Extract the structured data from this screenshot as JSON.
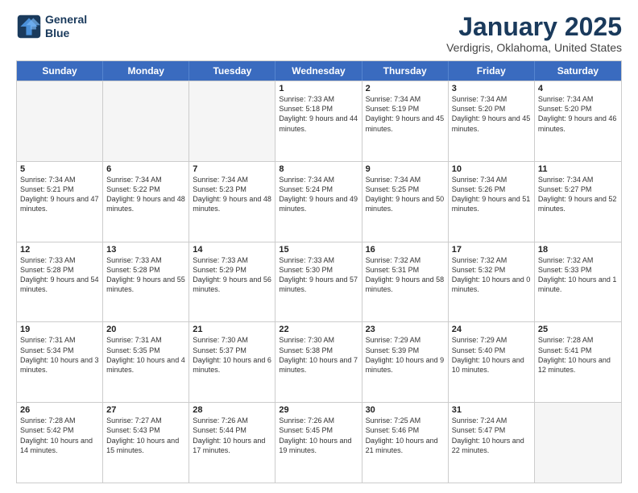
{
  "logo": {
    "line1": "General",
    "line2": "Blue"
  },
  "title": "January 2025",
  "location": "Verdigris, Oklahoma, United States",
  "days_of_week": [
    "Sunday",
    "Monday",
    "Tuesday",
    "Wednesday",
    "Thursday",
    "Friday",
    "Saturday"
  ],
  "weeks": [
    [
      {
        "num": "",
        "sunrise": "",
        "sunset": "",
        "daylight": "",
        "empty": true
      },
      {
        "num": "",
        "sunrise": "",
        "sunset": "",
        "daylight": "",
        "empty": true
      },
      {
        "num": "",
        "sunrise": "",
        "sunset": "",
        "daylight": "",
        "empty": true
      },
      {
        "num": "1",
        "sunrise": "Sunrise: 7:33 AM",
        "sunset": "Sunset: 5:18 PM",
        "daylight": "Daylight: 9 hours and 44 minutes."
      },
      {
        "num": "2",
        "sunrise": "Sunrise: 7:34 AM",
        "sunset": "Sunset: 5:19 PM",
        "daylight": "Daylight: 9 hours and 45 minutes."
      },
      {
        "num": "3",
        "sunrise": "Sunrise: 7:34 AM",
        "sunset": "Sunset: 5:20 PM",
        "daylight": "Daylight: 9 hours and 45 minutes."
      },
      {
        "num": "4",
        "sunrise": "Sunrise: 7:34 AM",
        "sunset": "Sunset: 5:20 PM",
        "daylight": "Daylight: 9 hours and 46 minutes."
      }
    ],
    [
      {
        "num": "5",
        "sunrise": "Sunrise: 7:34 AM",
        "sunset": "Sunset: 5:21 PM",
        "daylight": "Daylight: 9 hours and 47 minutes."
      },
      {
        "num": "6",
        "sunrise": "Sunrise: 7:34 AM",
        "sunset": "Sunset: 5:22 PM",
        "daylight": "Daylight: 9 hours and 48 minutes."
      },
      {
        "num": "7",
        "sunrise": "Sunrise: 7:34 AM",
        "sunset": "Sunset: 5:23 PM",
        "daylight": "Daylight: 9 hours and 48 minutes."
      },
      {
        "num": "8",
        "sunrise": "Sunrise: 7:34 AM",
        "sunset": "Sunset: 5:24 PM",
        "daylight": "Daylight: 9 hours and 49 minutes."
      },
      {
        "num": "9",
        "sunrise": "Sunrise: 7:34 AM",
        "sunset": "Sunset: 5:25 PM",
        "daylight": "Daylight: 9 hours and 50 minutes."
      },
      {
        "num": "10",
        "sunrise": "Sunrise: 7:34 AM",
        "sunset": "Sunset: 5:26 PM",
        "daylight": "Daylight: 9 hours and 51 minutes."
      },
      {
        "num": "11",
        "sunrise": "Sunrise: 7:34 AM",
        "sunset": "Sunset: 5:27 PM",
        "daylight": "Daylight: 9 hours and 52 minutes."
      }
    ],
    [
      {
        "num": "12",
        "sunrise": "Sunrise: 7:33 AM",
        "sunset": "Sunset: 5:28 PM",
        "daylight": "Daylight: 9 hours and 54 minutes."
      },
      {
        "num": "13",
        "sunrise": "Sunrise: 7:33 AM",
        "sunset": "Sunset: 5:28 PM",
        "daylight": "Daylight: 9 hours and 55 minutes."
      },
      {
        "num": "14",
        "sunrise": "Sunrise: 7:33 AM",
        "sunset": "Sunset: 5:29 PM",
        "daylight": "Daylight: 9 hours and 56 minutes."
      },
      {
        "num": "15",
        "sunrise": "Sunrise: 7:33 AM",
        "sunset": "Sunset: 5:30 PM",
        "daylight": "Daylight: 9 hours and 57 minutes."
      },
      {
        "num": "16",
        "sunrise": "Sunrise: 7:32 AM",
        "sunset": "Sunset: 5:31 PM",
        "daylight": "Daylight: 9 hours and 58 minutes."
      },
      {
        "num": "17",
        "sunrise": "Sunrise: 7:32 AM",
        "sunset": "Sunset: 5:32 PM",
        "daylight": "Daylight: 10 hours and 0 minutes."
      },
      {
        "num": "18",
        "sunrise": "Sunrise: 7:32 AM",
        "sunset": "Sunset: 5:33 PM",
        "daylight": "Daylight: 10 hours and 1 minute."
      }
    ],
    [
      {
        "num": "19",
        "sunrise": "Sunrise: 7:31 AM",
        "sunset": "Sunset: 5:34 PM",
        "daylight": "Daylight: 10 hours and 3 minutes."
      },
      {
        "num": "20",
        "sunrise": "Sunrise: 7:31 AM",
        "sunset": "Sunset: 5:35 PM",
        "daylight": "Daylight: 10 hours and 4 minutes."
      },
      {
        "num": "21",
        "sunrise": "Sunrise: 7:30 AM",
        "sunset": "Sunset: 5:37 PM",
        "daylight": "Daylight: 10 hours and 6 minutes."
      },
      {
        "num": "22",
        "sunrise": "Sunrise: 7:30 AM",
        "sunset": "Sunset: 5:38 PM",
        "daylight": "Daylight: 10 hours and 7 minutes."
      },
      {
        "num": "23",
        "sunrise": "Sunrise: 7:29 AM",
        "sunset": "Sunset: 5:39 PM",
        "daylight": "Daylight: 10 hours and 9 minutes."
      },
      {
        "num": "24",
        "sunrise": "Sunrise: 7:29 AM",
        "sunset": "Sunset: 5:40 PM",
        "daylight": "Daylight: 10 hours and 10 minutes."
      },
      {
        "num": "25",
        "sunrise": "Sunrise: 7:28 AM",
        "sunset": "Sunset: 5:41 PM",
        "daylight": "Daylight: 10 hours and 12 minutes."
      }
    ],
    [
      {
        "num": "26",
        "sunrise": "Sunrise: 7:28 AM",
        "sunset": "Sunset: 5:42 PM",
        "daylight": "Daylight: 10 hours and 14 minutes."
      },
      {
        "num": "27",
        "sunrise": "Sunrise: 7:27 AM",
        "sunset": "Sunset: 5:43 PM",
        "daylight": "Daylight: 10 hours and 15 minutes."
      },
      {
        "num": "28",
        "sunrise": "Sunrise: 7:26 AM",
        "sunset": "Sunset: 5:44 PM",
        "daylight": "Daylight: 10 hours and 17 minutes."
      },
      {
        "num": "29",
        "sunrise": "Sunrise: 7:26 AM",
        "sunset": "Sunset: 5:45 PM",
        "daylight": "Daylight: 10 hours and 19 minutes."
      },
      {
        "num": "30",
        "sunrise": "Sunrise: 7:25 AM",
        "sunset": "Sunset: 5:46 PM",
        "daylight": "Daylight: 10 hours and 21 minutes."
      },
      {
        "num": "31",
        "sunrise": "Sunrise: 7:24 AM",
        "sunset": "Sunset: 5:47 PM",
        "daylight": "Daylight: 10 hours and 22 minutes."
      },
      {
        "num": "",
        "sunrise": "",
        "sunset": "",
        "daylight": "",
        "empty": true
      }
    ]
  ]
}
